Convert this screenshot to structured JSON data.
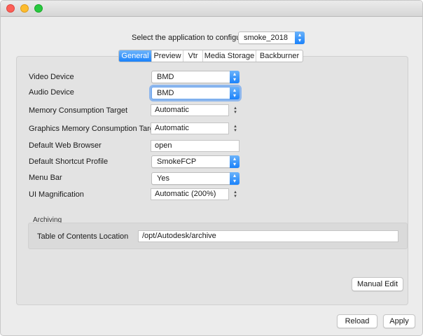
{
  "window": {
    "controls": [
      "close",
      "minimize",
      "zoom"
    ]
  },
  "app_select": {
    "label": "Select the application to configure",
    "value": "smoke_2018"
  },
  "tabs": [
    {
      "label": "General",
      "active": true
    },
    {
      "label": "Preview",
      "active": false
    },
    {
      "label": "Vtr",
      "active": false
    },
    {
      "label": "Media Storage",
      "active": false
    },
    {
      "label": "Backburner",
      "active": false
    }
  ],
  "fields": {
    "video_device": {
      "label": "Video Device",
      "value": "BMD"
    },
    "audio_device": {
      "label": "Audio Device",
      "value": "BMD"
    },
    "memory_target": {
      "label": "Memory Consumption Target",
      "value": "Automatic"
    },
    "graphics_memory_target": {
      "label": "Graphics Memory Consumption Target",
      "value": "Automatic"
    },
    "web_browser": {
      "label": "Default Web Browser",
      "value": "open"
    },
    "shortcut_profile": {
      "label": "Default Shortcut Profile",
      "value": "SmokeFCP"
    },
    "menu_bar": {
      "label": "Menu Bar",
      "value": "Yes"
    },
    "ui_magnification": {
      "label": "UI Magnification",
      "value": "Automatic (200%)"
    }
  },
  "archiving": {
    "title": "Archiving",
    "toc_label": "Table of Contents Location",
    "toc_value": "/opt/Autodesk/archive"
  },
  "buttons": {
    "manual_edit": "Manual Edit",
    "reload": "Reload",
    "apply": "Apply"
  },
  "colors": {
    "accent": "#1a82fb",
    "window_bg": "#ececec",
    "panel_bg": "#e3e3e3"
  }
}
